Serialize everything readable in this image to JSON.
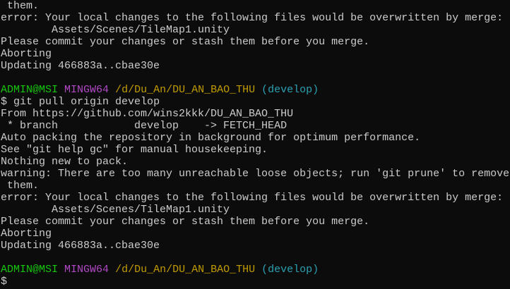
{
  "colors": {
    "background": "#0c0c0c",
    "text": "#cccccc",
    "user": "#16c60c",
    "system": "#b148c6",
    "path": "#c19c00",
    "branch": "#2aa1b3"
  },
  "block1": [
    " them.",
    "error: Your local changes to the following files would be overwritten by merge:",
    "        Assets/Scenes/TileMap1.unity",
    "Please commit your changes or stash them before you merge.",
    "Aborting",
    "Updating 466883a..cbae30e",
    ""
  ],
  "prompt": {
    "user": "ADMIN@MSI",
    "system": "MINGW64",
    "path": "/d/Du_An/DU_AN_BAO_THU",
    "branch": "(develop)",
    "symbol": "$"
  },
  "command": "git pull origin develop",
  "block2": [
    "From https://github.com/wins2kkk/DU_AN_BAO_THU",
    " * branch            develop    -> FETCH_HEAD",
    "Auto packing the repository in background for optimum performance.",
    "See \"git help gc\" for manual housekeeping.",
    "Nothing new to pack.",
    "warning: There are too many unreachable loose objects; run 'git prune' to remove",
    " them.",
    "error: Your local changes to the following files would be overwritten by merge:",
    "        Assets/Scenes/TileMap1.unity",
    "Please commit your changes or stash them before you merge.",
    "Aborting",
    "Updating 466883a..cbae30e",
    ""
  ]
}
